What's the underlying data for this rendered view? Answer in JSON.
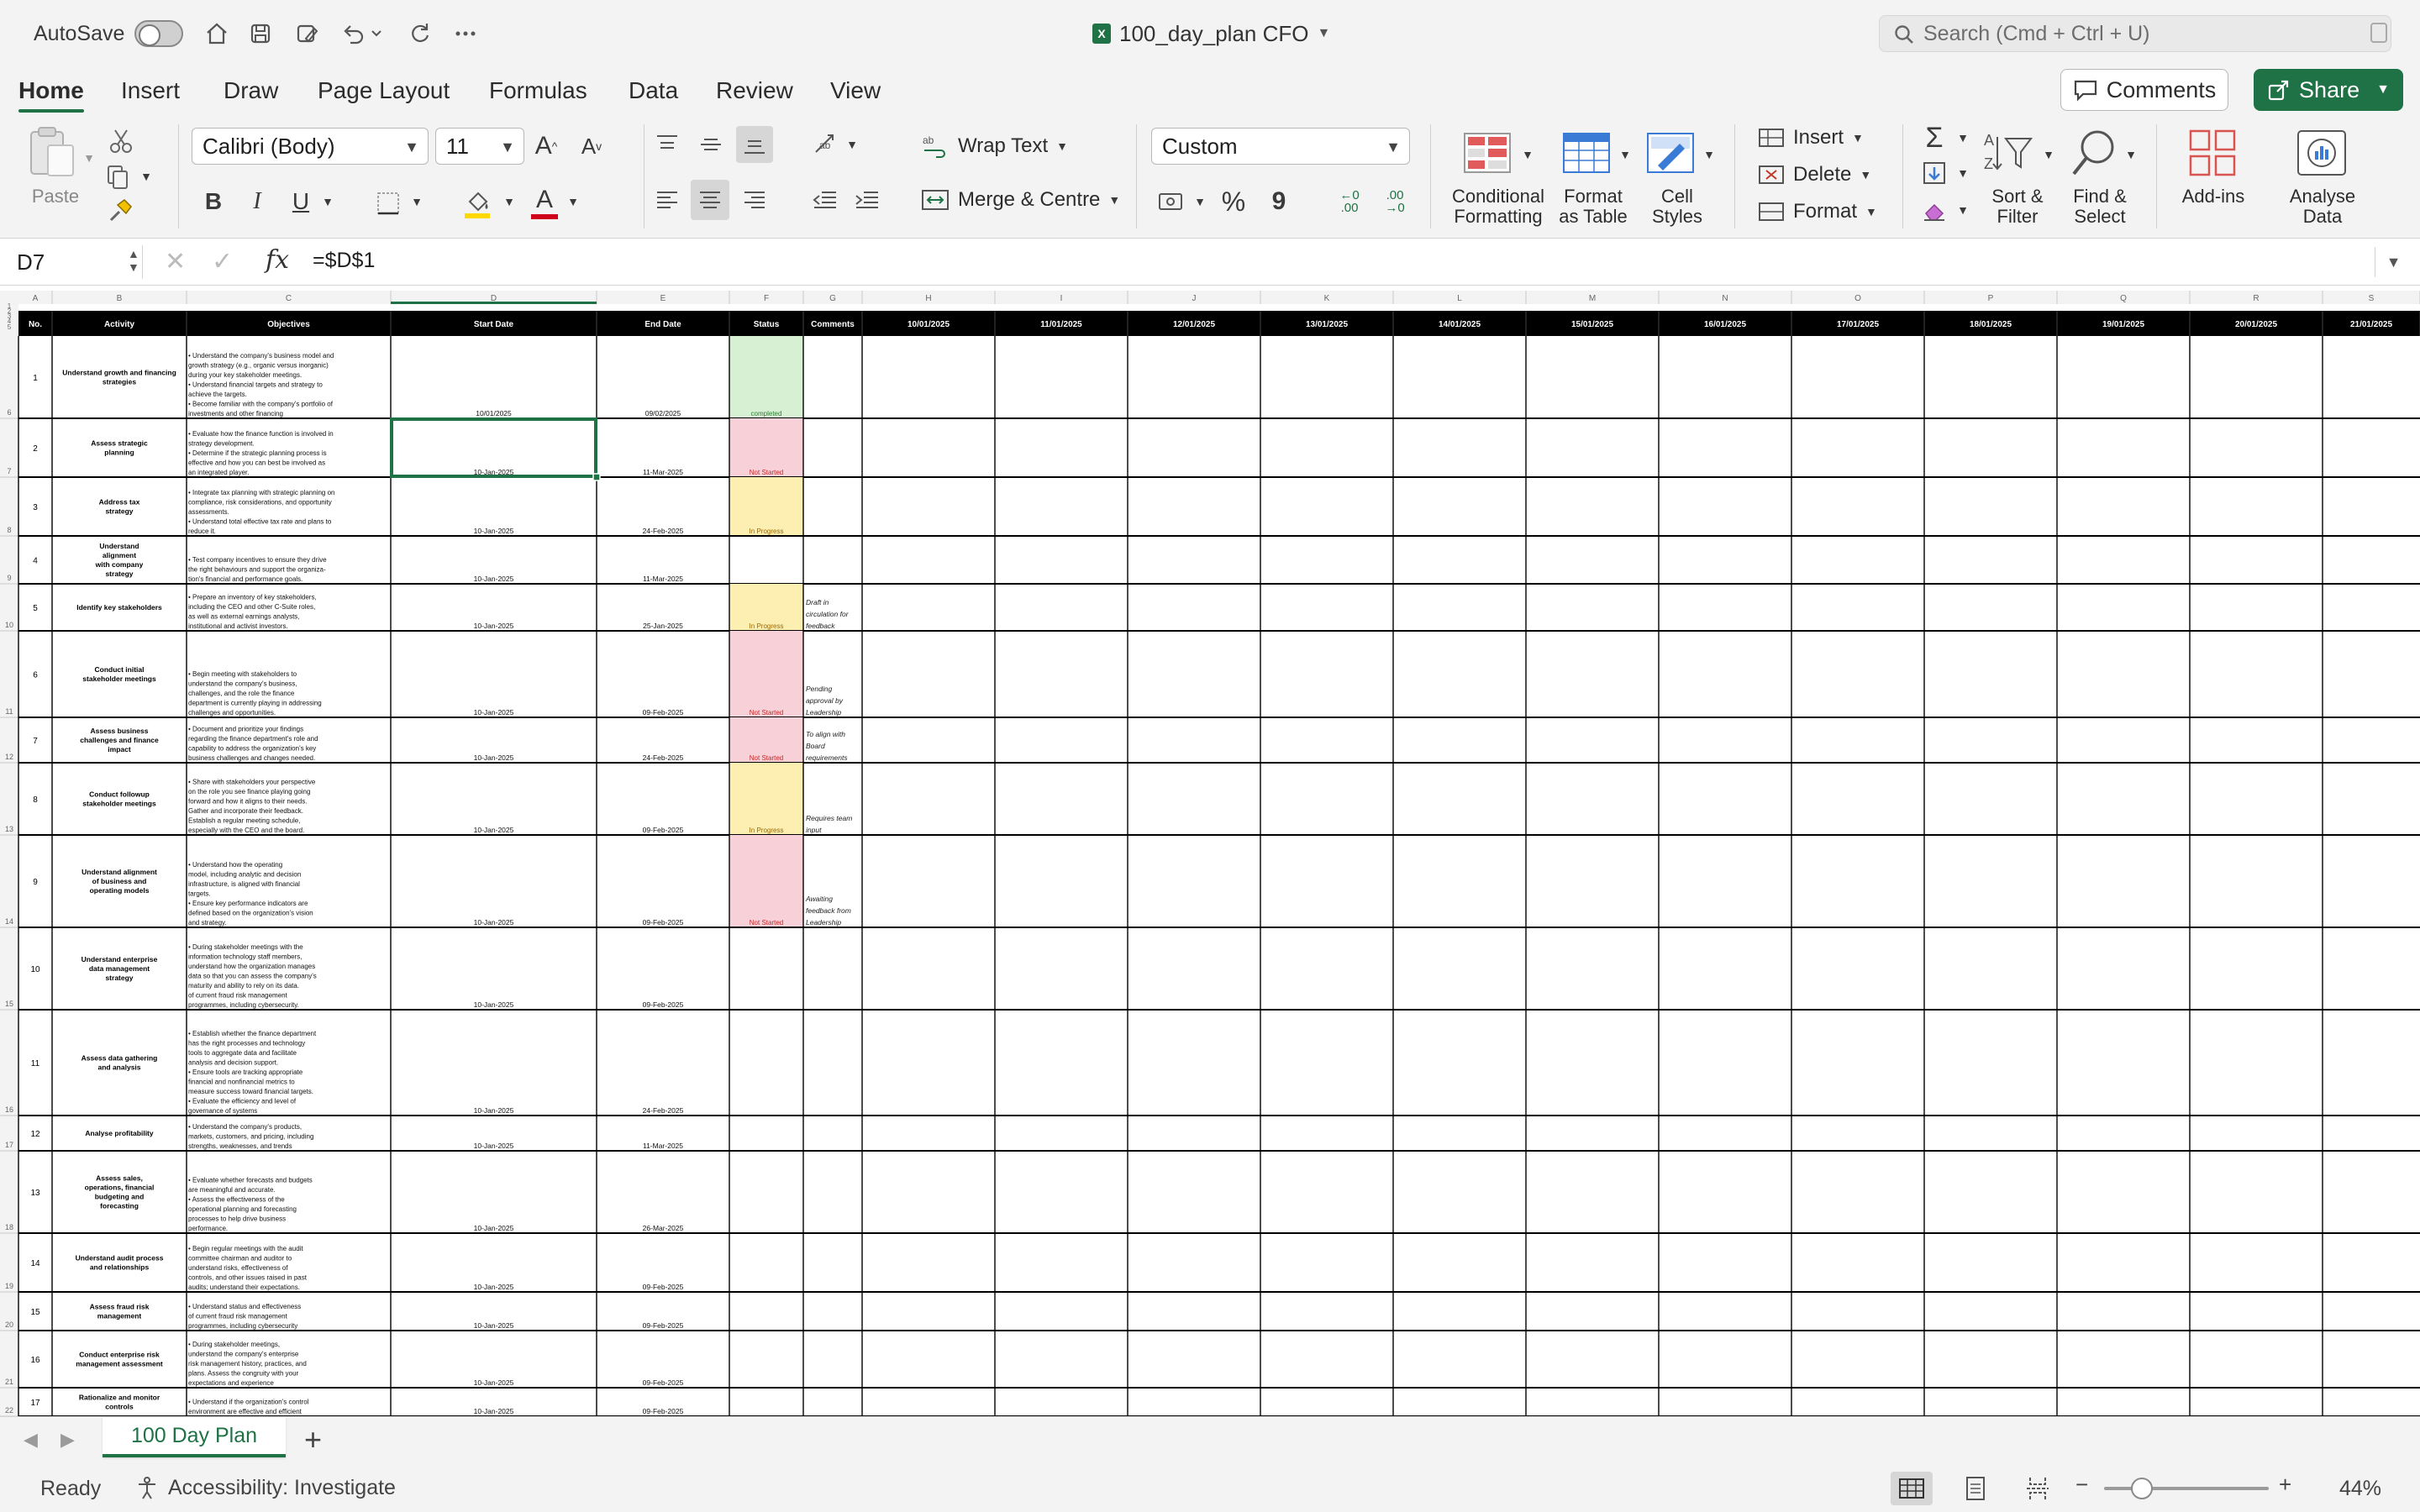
{
  "titlebar": {
    "autosave_label": "AutoSave",
    "doc_title": "100_day_plan CFO",
    "search_placeholder": "Search (Cmd + Ctrl + U)"
  },
  "ribbon_tabs": [
    "Home",
    "Insert",
    "Draw",
    "Page Layout",
    "Formulas",
    "Data",
    "Review",
    "View"
  ],
  "active_tab": "Home",
  "header_buttons": {
    "comments": "Comments",
    "share": "Share"
  },
  "ribbon": {
    "paste": "Paste",
    "font_name": "Calibri (Body)",
    "font_size": "11",
    "wrap_text": "Wrap Text",
    "merge_centre": "Merge & Centre",
    "number_format": "Custom",
    "bold": "B",
    "italic": "I",
    "underline": "U",
    "grow_font": "A",
    "shrink_font": "A",
    "font_color": "A",
    "percent": "%",
    "comma": "9",
    "decrease_decimal": ".00",
    "increase_decimal": ".00",
    "cond_format_1": "Conditional",
    "cond_format_2": "Formatting",
    "format_table_1": "Format",
    "format_table_2": "as Table",
    "cell_styles_1": "Cell",
    "cell_styles_2": "Styles",
    "insert": "Insert",
    "delete": "Delete",
    "format": "Format",
    "sort_filter_1": "Sort &",
    "sort_filter_2": "Filter",
    "find_select_1": "Find &",
    "find_select_2": "Select",
    "addins": "Add-ins",
    "analyse_1": "Analyse",
    "analyse_2": "Data"
  },
  "formula_bar": {
    "name_box": "D7",
    "fx": "fx",
    "formula": "=$D$1"
  },
  "sheet": {
    "col_letters": [
      "A",
      "B",
      "C",
      "D",
      "E",
      "F",
      "G",
      "H",
      "I",
      "J",
      "K",
      "L",
      "M",
      "N",
      "O",
      "P",
      "Q",
      "R",
      "S"
    ],
    "headers": [
      "No.",
      "Activity",
      "Objectives",
      "Start Date",
      "End Date",
      "Status",
      "Comments",
      "10/01/2025",
      "11/01/2025",
      "12/01/2025",
      "13/01/2025",
      "14/01/2025",
      "15/01/2025",
      "16/01/2025",
      "17/01/2025",
      "18/01/2025",
      "19/01/2025",
      "20/01/2025",
      "21/01/2025"
    ],
    "top_row_numbers": [
      "1",
      "2",
      "3",
      "4",
      "5"
    ],
    "rows": [
      {
        "rownum": "6",
        "no": "1",
        "activity": [
          "Understand growth and financing",
          "strategies"
        ],
        "objectives": [
          "• Understand the company's business model and",
          "growth strategy (e.g., organic versus inorganic)",
          "during your key stakeholder meetings.",
          "• Understand financial targets and strategy to",
          "achieve the targets.",
          "• Become familiar with the company's portfolio of",
          "investments and other financing"
        ],
        "start": "10/01/2025",
        "end": "09/02/2025",
        "status": "completed",
        "comments": []
      },
      {
        "rownum": "7",
        "no": "2",
        "activity": [
          "Assess strategic",
          "planning"
        ],
        "objectives": [
          "• Evaluate how the finance function is involved in",
          "strategy development.",
          "• Determine if the strategic planning process is",
          "effective and how you can best be involved as",
          "an integrated player."
        ],
        "start": "10-Jan-2025",
        "end": "11-Mar-2025",
        "status": "Not Started",
        "comments": []
      },
      {
        "rownum": "8",
        "no": "3",
        "activity": [
          "Address tax",
          "strategy"
        ],
        "objectives": [
          "• Integrate tax planning with strategic planning on",
          "compliance, risk considerations, and opportunity",
          "assessments.",
          "• Understand total effective tax rate and plans to",
          "reduce it."
        ],
        "start": "10-Jan-2025",
        "end": "24-Feb-2025",
        "status": "In Progress",
        "comments": []
      },
      {
        "rownum": "9",
        "no": "4",
        "activity": [
          "Understand",
          "alignment",
          "with company",
          "strategy"
        ],
        "objectives": [
          "• Test company incentives to ensure they drive",
          "the right behaviours and support the organiza-",
          "tion's financial and performance goals."
        ],
        "start": "10-Jan-2025",
        "end": "11-Mar-2025",
        "status": "",
        "comments": []
      },
      {
        "rownum": "10",
        "no": "5",
        "activity": [
          "Identify key stakeholders"
        ],
        "objectives": [
          "• Prepare an inventory of key stakeholders,",
          "including the CEO and other C-Suite roles,",
          "as well as external earnings analysts,",
          "institutional and activist investors."
        ],
        "start": "10-Jan-2025",
        "end": "25-Jan-2025",
        "status": "In Progress",
        "comments": [
          "Draft in",
          "circulation for",
          "feedback"
        ]
      },
      {
        "rownum": "11",
        "no": "6",
        "activity": [
          "Conduct initial",
          "stakeholder meetings"
        ],
        "objectives": [
          "• Begin meeting with stakeholders to",
          "understand the company's business,",
          "challenges, and the role the finance",
          "department is currently playing in addressing",
          "challenges and opportunities."
        ],
        "start": "10-Jan-2025",
        "end": "09-Feb-2025",
        "status": "Not Started",
        "comments": [
          "Pending",
          "approval by",
          "Leadership"
        ]
      },
      {
        "rownum": "12",
        "no": "7",
        "activity": [
          "Assess business",
          "challenges and finance",
          "impact"
        ],
        "objectives": [
          "• Document and prioritize your findings",
          "regarding the finance department's role and",
          "capability to address the organization's key",
          "business challenges and changes needed."
        ],
        "start": "10-Jan-2025",
        "end": "24-Feb-2025",
        "status": "Not Started",
        "comments": [
          "To align with",
          "Board",
          "requirements"
        ]
      },
      {
        "rownum": "13",
        "no": "8",
        "activity": [
          "Conduct followup",
          "stakeholder meetings"
        ],
        "objectives": [
          "• Share with stakeholders your perspective",
          "on the role you see finance playing going",
          "forward and how it aligns to their needs.",
          "Gather and incorporate their feedback.",
          "Establish a regular meeting schedule,",
          "especially with the CEO and the board."
        ],
        "start": "10-Jan-2025",
        "end": "09-Feb-2025",
        "status": "In Progress",
        "comments": [
          "Requires team",
          "input"
        ]
      },
      {
        "rownum": "14",
        "no": "9",
        "activity": [
          "Understand alignment",
          "of business and",
          "operating models"
        ],
        "objectives": [
          "• Understand how the operating",
          "model, including analytic and decision",
          "infrastructure, is aligned with financial",
          "targets.",
          "• Ensure key performance indicators are",
          "defined based on the organization's vision",
          "and strategy."
        ],
        "start": "10-Jan-2025",
        "end": "09-Feb-2025",
        "status": "Not Started",
        "comments": [
          "Awaiting",
          "feedback from",
          "Leadership"
        ]
      },
      {
        "rownum": "15",
        "no": "10",
        "activity": [
          "Understand enterprise",
          "data management",
          "strategy"
        ],
        "objectives": [
          "• During stakeholder meetings with the",
          "information technology staff members,",
          "understand how the organization manages",
          "data so that you can assess the company's",
          "maturity and ability to rely on its data.",
          "of current fraud risk management",
          "programmes, including cybersecurity."
        ],
        "start": "10-Jan-2025",
        "end": "09-Feb-2025",
        "status": "",
        "comments": []
      },
      {
        "rownum": "16",
        "no": "11",
        "activity": [
          "Assess data gathering",
          "and analysis"
        ],
        "objectives": [
          "• Establish whether the finance department",
          "has the right processes and technology",
          "tools to aggregate data and facilitate",
          "analysis and decision support.",
          "• Ensure tools are tracking appropriate",
          "financial and nonfinancial metrics to",
          "measure success toward financial targets.",
          "• Evaluate the efficiency and level of",
          "governance of systems"
        ],
        "start": "10-Jan-2025",
        "end": "24-Feb-2025",
        "status": "",
        "comments": []
      },
      {
        "rownum": "17",
        "no": "12",
        "activity": [
          "Analyse profitability"
        ],
        "objectives": [
          "• Understand the company's products,",
          "markets, customers, and pricing, including",
          "strengths, weaknesses, and trends"
        ],
        "start": "10-Jan-2025",
        "end": "11-Mar-2025",
        "status": "",
        "comments": []
      },
      {
        "rownum": "18",
        "no": "13",
        "activity": [
          "Assess sales,",
          "operations, financial",
          "budgeting and",
          "forecasting"
        ],
        "objectives": [
          "• Evaluate whether forecasts and budgets",
          "are meaningful and accurate.",
          "• Assess the effectiveness of the",
          "operational planning and forecasting",
          "processes to help drive business",
          "performance."
        ],
        "start": "10-Jan-2025",
        "end": "26-Mar-2025",
        "status": "",
        "comments": []
      },
      {
        "rownum": "19",
        "no": "14",
        "activity": [
          "Understand audit process",
          "and relationships"
        ],
        "objectives": [
          "• Begin regular meetings with the audit",
          "committee chairman and auditor to",
          "understand risks, effectiveness of",
          "controls, and other issues raised in past",
          "audits; understand their expectations."
        ],
        "start": "10-Jan-2025",
        "end": "09-Feb-2025",
        "status": "",
        "comments": []
      },
      {
        "rownum": "20",
        "no": "15",
        "activity": [
          "Assess fraud risk",
          "management"
        ],
        "objectives": [
          "• Understand status and effectiveness",
          "of current fraud risk management",
          "programmes, including cybersecurity"
        ],
        "start": "10-Jan-2025",
        "end": "09-Feb-2025",
        "status": "",
        "comments": []
      },
      {
        "rownum": "21",
        "no": "16",
        "activity": [
          "Conduct enterprise risk",
          "management assessment"
        ],
        "objectives": [
          "• During stakeholder meetings,",
          "understand the company's enterprise",
          "risk management history, practices, and",
          "plans. Assess the congruity with your",
          "expectations and experience"
        ],
        "start": "10-Jan-2025",
        "end": "09-Feb-2025",
        "status": "",
        "comments": []
      },
      {
        "rownum": "22",
        "no": "17",
        "activity": [
          "Rationalize and monitor",
          "controls"
        ],
        "objectives": [
          "• Understand if the organization's control",
          "environment are effective and efficient"
        ],
        "start": "10-Jan-2025",
        "end": "09-Feb-2025",
        "status": "",
        "comments": []
      }
    ]
  },
  "status_colors": {
    "completed": "#d7f0d4",
    "Not Started": "#f8d0d8",
    "In Progress": "#fdefb2"
  },
  "status_text_colors": {
    "completed": "#2e7d32",
    "Not Started": "#c62828",
    "In Progress": "#9c6500"
  },
  "sheet_tabs": [
    "100 Day Plan"
  ],
  "statusbar": {
    "ready": "Ready",
    "accessibility": "Accessibility: Investigate",
    "zoom": "44%"
  },
  "accent_color": "#1f7245"
}
